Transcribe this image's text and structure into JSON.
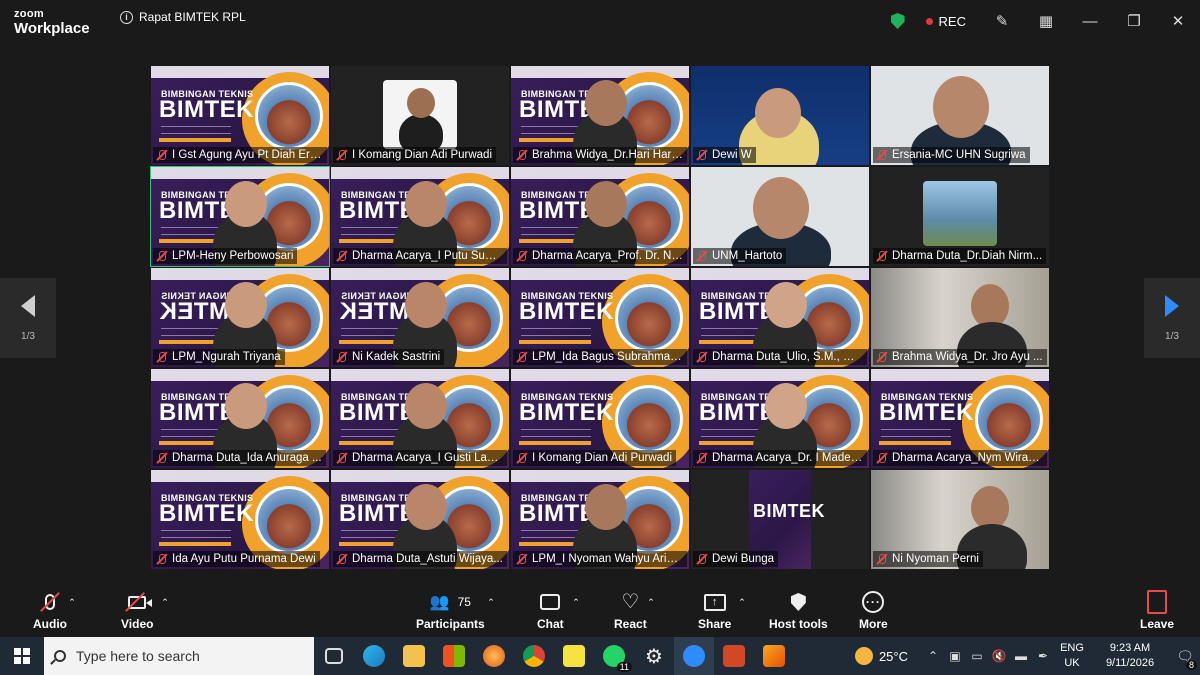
{
  "app": {
    "brand_line1": "zoom",
    "brand_line2": "Workplace",
    "meeting_title": "Rapat BIMTEK RPL",
    "rec_label": "REC"
  },
  "paging": {
    "page_left": "1/3",
    "page_right": "1/3"
  },
  "poster": {
    "line1": "BIMBINGAN TEKNIS",
    "line2": "BIMTEK"
  },
  "participants": [
    {
      "name": "I Gst Agung Ayu Pt Diah Erik..."
    },
    {
      "name": "I Komang Dian Adi Purwadi"
    },
    {
      "name": "Brahma Widya_Dr.Hari Hars..."
    },
    {
      "name": "Dewi W"
    },
    {
      "name": "Ersania-MC UHN Sugriwa"
    },
    {
      "name": "LPM-Heny Perbowosari"
    },
    {
      "name": "Dharma Acarya_I Putu Suwe..."
    },
    {
      "name": "Dharma Acarya_Prof. Dr. Ni ..."
    },
    {
      "name": "UNM_Hartoto"
    },
    {
      "name": "Dharma Duta_Dr.Diah Nirm..."
    },
    {
      "name": "LPM_Ngurah Triyana"
    },
    {
      "name": "Ni Kadek Sastrini"
    },
    {
      "name": "LPM_Ida Bagus Subrahmaniam ..."
    },
    {
      "name": "Dharma Duta_Ulio, S.M., M.I...."
    },
    {
      "name": "Brahma Widya_Dr. Jro Ayu ..."
    },
    {
      "name": "Dharma Duta_Ida Anuraga ..."
    },
    {
      "name": "Dharma Acarya_I Gusti Lana..."
    },
    {
      "name": "I Komang Dian Adi Purwadi"
    },
    {
      "name": "Dharma Acarya_Dr. I Made L..."
    },
    {
      "name": "Dharma Acarya_Nym Wiraa..."
    },
    {
      "name": "Ida Ayu Putu Purnama Dewi"
    },
    {
      "name": "Dharma Duta_Astuti Wijaya..."
    },
    {
      "name": "LPM_I Nyoman Wahyu Ariar..."
    },
    {
      "name": "Dewi Bunga"
    },
    {
      "name": "Ni Nyoman Perni"
    }
  ],
  "toolbar": {
    "audio": "Audio",
    "video": "Video",
    "participants": "Participants",
    "participants_count": "75",
    "chat": "Chat",
    "react": "React",
    "share": "Share",
    "host_tools": "Host tools",
    "more": "More",
    "leave": "Leave"
  },
  "taskbar": {
    "search_placeholder": "Type here to search",
    "whatsapp_badge": "11",
    "temperature": "25°C",
    "lang1": "ENG",
    "lang2": "UK",
    "time": "9:23 AM",
    "date": "9/11/2026",
    "notif_count": "8"
  },
  "colors": {
    "accent": "#2d8cff",
    "active_speaker": "#2ec27e",
    "mute": "#e84a4a",
    "poster_purple": "#3a1f5c",
    "poster_orange": "#f0a22a"
  }
}
